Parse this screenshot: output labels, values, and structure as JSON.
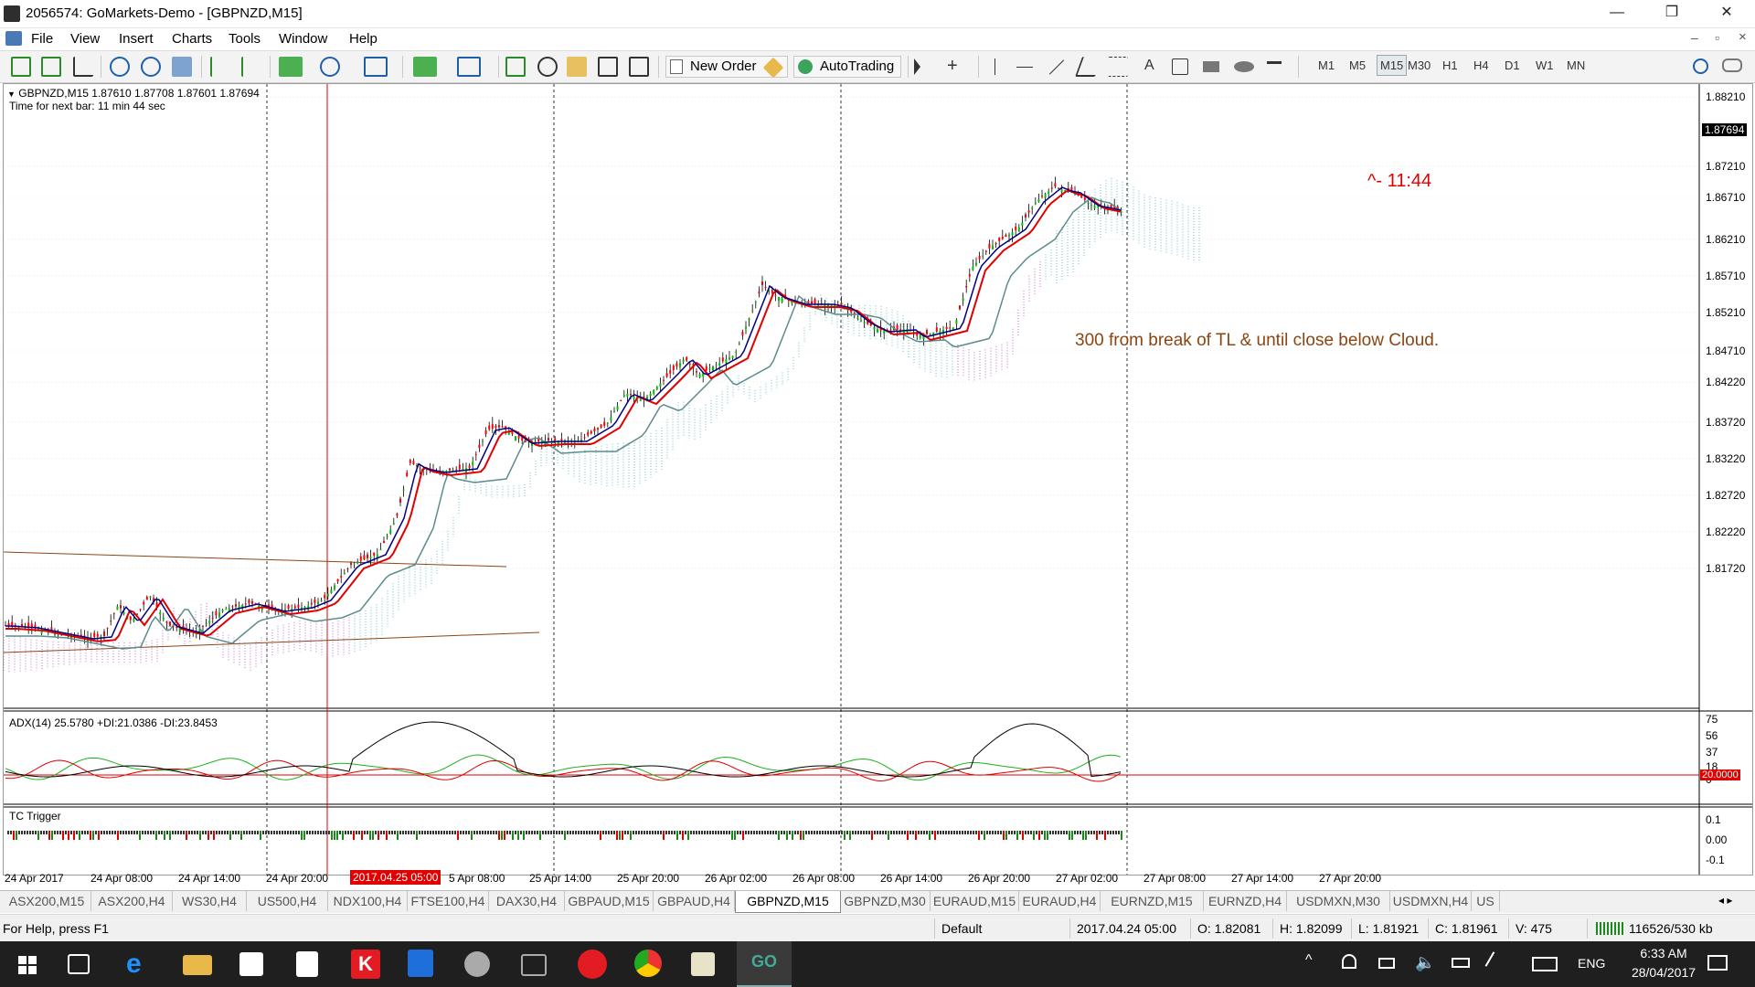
{
  "window": {
    "title": "2056574: GoMarkets-Demo - [GBPNZD,M15]",
    "controls": [
      "—",
      "❐",
      "✕"
    ],
    "inner_controls": [
      "–",
      "▫",
      "×"
    ]
  },
  "menu": [
    "File",
    "View",
    "Insert",
    "Charts",
    "Tools",
    "Window",
    "Help"
  ],
  "toolbar": {
    "new_order_label": "New Order",
    "autotrading_label": "AutoTrading",
    "timeframes": [
      "M1",
      "M5",
      "M15",
      "M30",
      "H1",
      "H4",
      "D1",
      "W1",
      "MN"
    ],
    "active_timeframe": "M15"
  },
  "chart": {
    "header": "GBPNZD,M15  1.87610 1.87708 1.87601 1.87694",
    "next_bar": "Time for next bar: 11 min 44 sec",
    "countdown": "^- 11:44",
    "annotation": "300 from break of TL & until close below Cloud.",
    "price_labels": [
      "1.88210",
      "1.87210",
      "1.86710",
      "1.86210",
      "1.85710",
      "1.85210",
      "1.84710",
      "1.84220",
      "1.83720",
      "1.83220",
      "1.82720",
      "1.82220",
      "1.81720"
    ],
    "current_price": "1.87694",
    "time_labels": [
      "24 Apr 2017",
      "24 Apr 08:00",
      "24 Apr 14:00",
      "24 Apr 20:00",
      "5 Apr 08:00",
      "25 Apr 14:00",
      "25 Apr 20:00",
      "26 Apr 02:00",
      "26 Apr 08:00",
      "26 Apr 14:00",
      "26 Apr 20:00",
      "27 Apr 02:00",
      "27 Apr 08:00",
      "27 Apr 14:00",
      "27 Apr 20:00"
    ],
    "highlight_time": "2017.04.25 05:00",
    "colors": {
      "price_up": "#00c000",
      "price_down": "#ff0000",
      "ma_fast": "#e00000",
      "ma_mid": "#000080",
      "ma_slow": "#5b8c8c",
      "cloud_a": "#40b0c0",
      "cloud_b": "#c040c0",
      "trendline": "#8b4513",
      "annotation": "#8b4513",
      "countdown": "#e00000"
    }
  },
  "adx": {
    "label": "ADX(14) 25.5780 +DI:21.0386 -DI:23.8453",
    "levels": [
      "75",
      "56",
      "37",
      "18",
      "0"
    ],
    "level_marker": "20.0000"
  },
  "tc": {
    "label": "TC Trigger",
    "levels": [
      "0.1",
      "0.00",
      "-0.1"
    ]
  },
  "tabs": [
    "ASX200,M15",
    "ASX200,H4",
    "WS30,H4",
    "US500,H4",
    "NDX100,H4",
    "FTSE100,H4",
    "DAX30,H4",
    "GBPAUD,M15",
    "GBPAUD,H4",
    "GBPNZD,M15",
    "GBPNZD,M30",
    "EURAUD,M15",
    "EURAUD,H4",
    "EURNZD,M15",
    "EURNZD,H4",
    "USDMXN,M30",
    "USDMXN,H4",
    "US"
  ],
  "active_tab": "GBPNZD,M15",
  "status": {
    "help": "For Help, press F1",
    "profile": "Default",
    "datetime": "2017.04.24 05:00",
    "open": "O: 1.82081",
    "high": "H: 1.82099",
    "low": "L: 1.81921",
    "close": "C: 1.81961",
    "volume": "V: 475",
    "traffic": "116526/530 kb"
  },
  "taskbar": {
    "lang": "ENG",
    "time": "6:33 AM",
    "date": "28/04/2017"
  }
}
